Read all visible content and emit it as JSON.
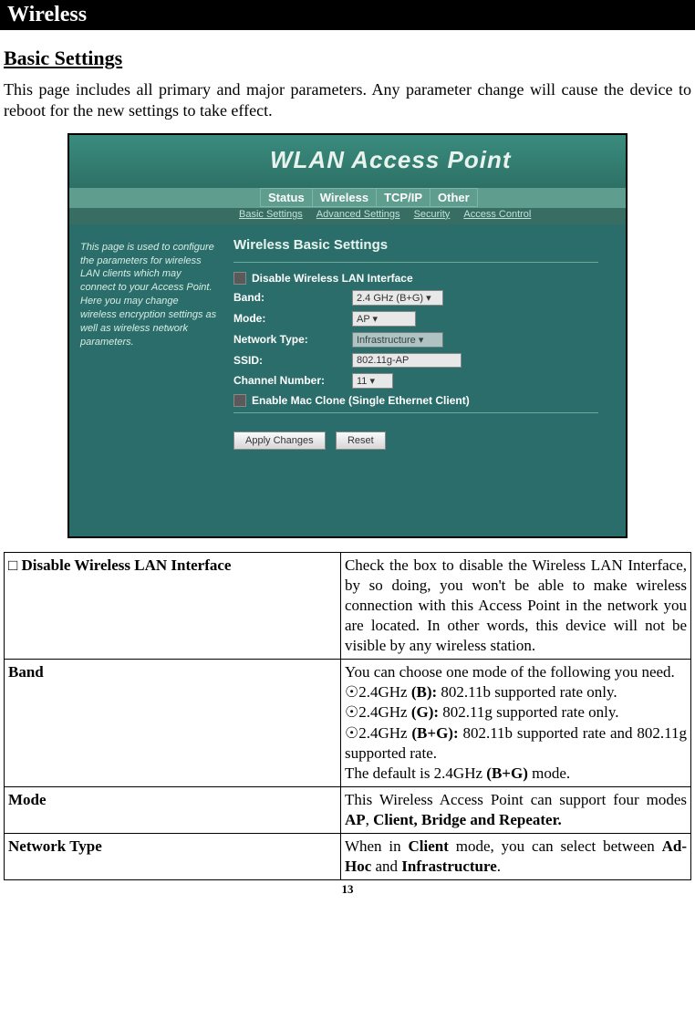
{
  "header": {
    "title": "Wireless"
  },
  "section": {
    "title": "Basic Settings",
    "intro": "This page includes all primary and major parameters.  Any parameter change will cause the device to reboot for the new settings to take effect."
  },
  "screenshot": {
    "app_title": "WLAN Access Point",
    "tabs": [
      "Status",
      "Wireless",
      "TCP/IP",
      "Other"
    ],
    "subtabs": [
      "Basic Settings",
      "Advanced Settings",
      "Security",
      "Access Control"
    ],
    "sidebar_help": "This page is used to configure the parameters for wireless LAN clients which may connect to your Access Point. Here you may change wireless encryption settings as well as wireless network parameters.",
    "form_title": "Wireless Basic Settings",
    "disable_label": "Disable Wireless LAN Interface",
    "fields": {
      "band_label": "Band:",
      "band_value": "2.4 GHz (B+G)",
      "mode_label": "Mode:",
      "mode_value": "AP",
      "nettype_label": "Network Type:",
      "nettype_value": "Infrastructure",
      "ssid_label": "SSID:",
      "ssid_value": "802.11g-AP",
      "chan_label": "Channel Number:",
      "chan_value": "11",
      "mac_clone_label": "Enable Mac Clone (Single Ethernet Client)"
    },
    "buttons": {
      "apply": "Apply Changes",
      "reset": "Reset"
    }
  },
  "params": [
    {
      "label_prefix": "□ ",
      "label": "Disable Wireless LAN Interface",
      "desc_html": "Check the box to disable the Wireless LAN Interface, by so doing, you won't be able to make wireless connection with this Access Point in the network you are located. In other words, this device will not be visible by any wireless station."
    },
    {
      "label_prefix": "",
      "label": "Band",
      "desc_intro": "You can choose one mode of the following you need.",
      "desc_lines": [
        {
          "bullet": "☉",
          "pre": "2.4GHz ",
          "bold": "(B):",
          "rest": " 802.11b supported rate only."
        },
        {
          "bullet": "☉",
          "pre": "2.4GHz ",
          "bold": "(G):",
          "rest": " 802.11g supported rate only."
        },
        {
          "bullet": "☉",
          "pre": "2.4GHz ",
          "bold": "(B+G):",
          "rest": " 802.11b supported rate and 802.11g supported rate."
        }
      ],
      "desc_default_pre": "The default is  2.4GHz ",
      "desc_default_bold": "(B+G)",
      "desc_default_post": " mode."
    },
    {
      "label_prefix": "",
      "label": "Mode",
      "desc_pre": "This Wireless Access Point can support four modes ",
      "desc_bold": "AP",
      "desc_mid": ", ",
      "desc_bold2": "Client, Bridge and Repeater.",
      "desc_post": ""
    },
    {
      "label_prefix": "",
      "label": "Network Type",
      "desc_pre": "When in ",
      "desc_bold": "Client",
      "desc_mid": " mode, you can select between ",
      "desc_bold2": "Ad-Hoc",
      "desc_mid2": " and ",
      "desc_bold3": "Infrastructure",
      "desc_post": "."
    }
  ],
  "page_number": "13"
}
